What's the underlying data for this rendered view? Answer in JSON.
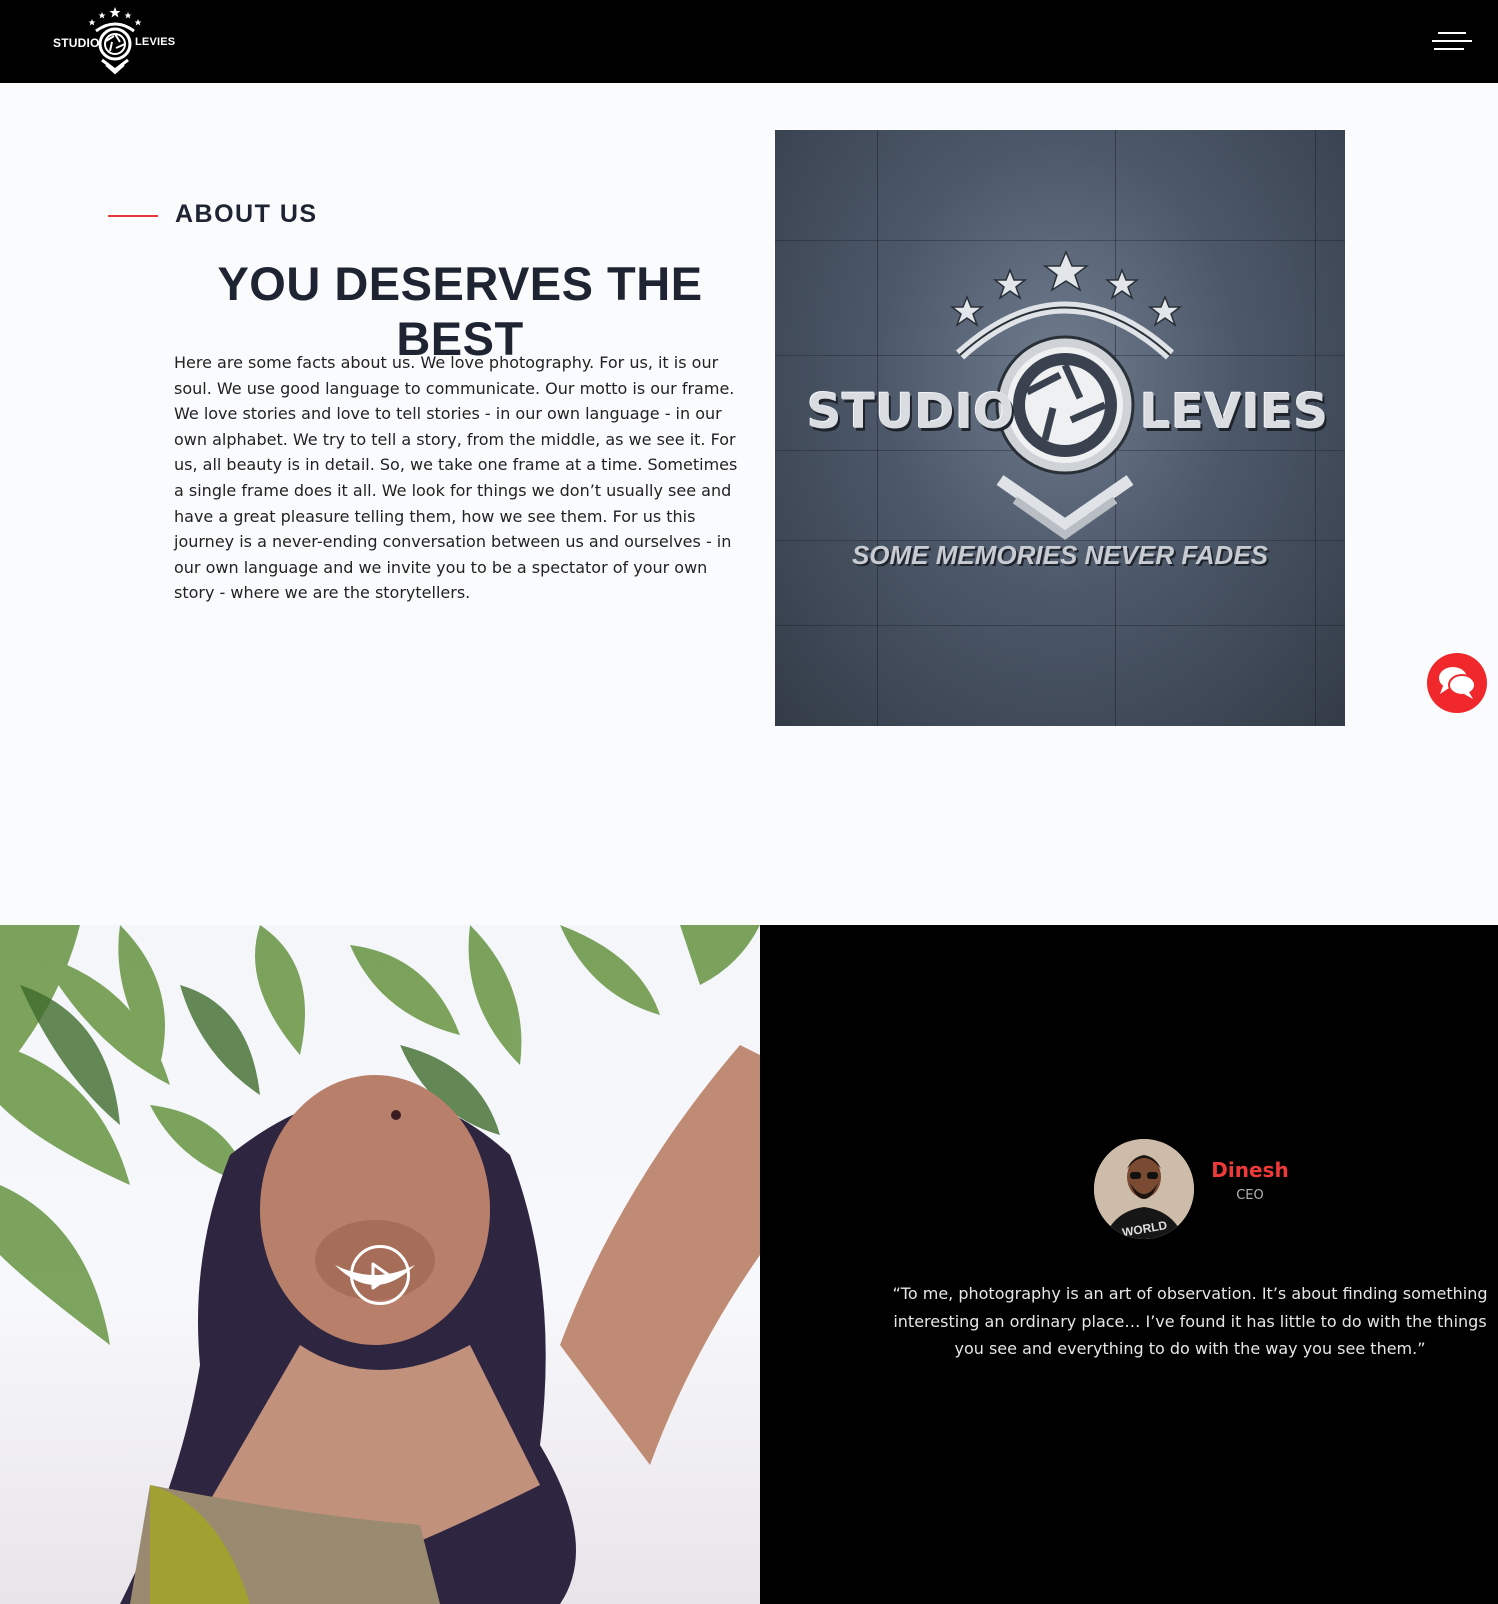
{
  "header": {
    "logo_left": "STUDIO",
    "logo_right": "LEVIES",
    "menu_icon": "hamburger-menu-icon"
  },
  "about": {
    "label": "ABOUT US",
    "title": "YOU DESERVES THE BEST",
    "body": "Here are some facts about us. We love photography. For us, it is our soul. We use good language to communicate. Our motto is our frame. We love stories and love to tell stories - in our own language - in our own alphabet. We try to tell a story, from the middle, as we see it. For us, all beauty is in detail. So, we take one frame at a time. Sometimes a single frame does it all. We look for things we don’t usually see and have a great pleasure telling them, how we see them. For us this journey is a never-ending conversation between us and ourselves - in our own language and we invite you to be a spectator of your own story - where we are the storytellers.",
    "image": {
      "word_left": "STUDIO",
      "word_right": "LEVIES",
      "tagline": "SOME MEMORIES NEVER FADES"
    }
  },
  "chat": {
    "icon": "chat-bubbles-icon"
  },
  "video": {
    "icon": "play-icon"
  },
  "testimonial": {
    "name": "Dinesh",
    "role": "CEO",
    "quote": "“To me, photography is an art of observation. It’s about finding something interesting an ordinary place… I’ve found it has little to do with the things you see and everything to do with the way you see them.”"
  },
  "colors": {
    "accent": "#e53935",
    "header_bg": "#000000",
    "heading": "#1e2432",
    "name": "#f03a3a"
  }
}
